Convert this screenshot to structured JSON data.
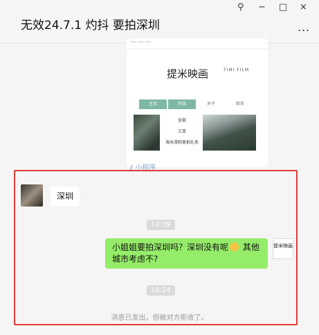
{
  "window": {
    "title": "无效24.7.1 灼抖 要拍深圳",
    "pin_icon": "pin-icon",
    "minimize": "−",
    "maximize": "□",
    "close": "×",
    "more": "..."
  },
  "mini_program_card": {
    "logo_cn": "提米映画",
    "logo_en": "TIMI FILM",
    "tabs": [
      "主页",
      "作品",
      "关于",
      "联系"
    ],
    "lines": [
      "全部",
      "三亚",
      "海水湾和美拍礼系"
    ],
    "footer_label": "小程序"
  },
  "messages": {
    "incoming_text": "深圳",
    "time1": "14:39",
    "outgoing_text_part1": "小姐姐要拍深圳吗？深圳没有呢",
    "outgoing_text_part2": " 其他城市考虑不?",
    "time2": "16:24",
    "notice": "消息已发出，但被对方拒收了。",
    "right_avatar_text": "提米映画"
  },
  "colors": {
    "bubble_outgoing": "#95ec69",
    "highlight_box": "#e53935",
    "tab_green": "#7fb8a6"
  }
}
